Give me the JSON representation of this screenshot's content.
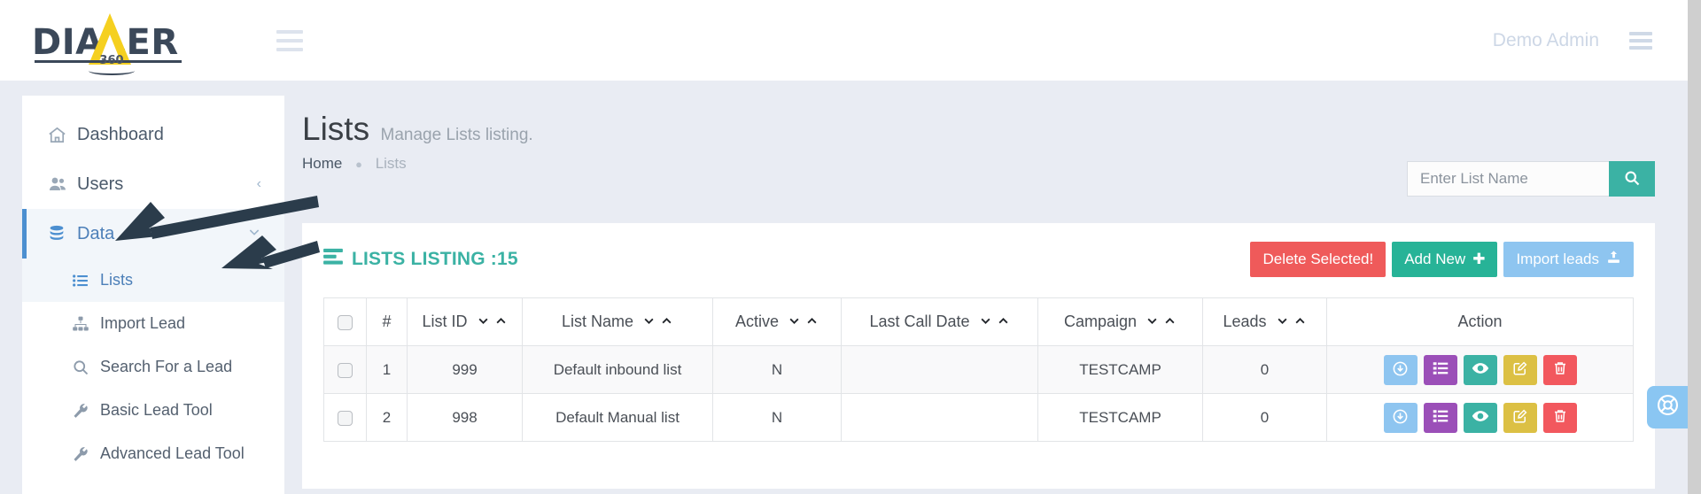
{
  "navbar": {
    "logo_text": "DIALER",
    "logo_badge": "360",
    "menu_toggle_icon": "hamburger-icon",
    "user_name": "Demo Admin",
    "right_menu_icon": "hamburger-icon"
  },
  "sidebar": {
    "items": [
      {
        "label": "Dashboard",
        "icon": "home-icon",
        "state": "normal",
        "caret": ""
      },
      {
        "label": "Users",
        "icon": "users-icon",
        "state": "normal",
        "caret": "‹"
      },
      {
        "label": "Data",
        "icon": "database-icon",
        "state": "active",
        "caret": "⌄"
      }
    ],
    "subitems": [
      {
        "label": "Lists",
        "icon": "list-ul-icon",
        "state": "selected"
      },
      {
        "label": "Import Lead",
        "icon": "sitemap-icon",
        "state": "normal"
      },
      {
        "label": "Search For a Lead",
        "icon": "search-icon",
        "state": "normal"
      },
      {
        "label": "Basic Lead Tool",
        "icon": "wrench-icon",
        "state": "normal"
      },
      {
        "label": "Advanced Lead Tool",
        "icon": "wrench-icon",
        "state": "normal"
      }
    ]
  },
  "page": {
    "title": "Lists",
    "subtitle": "Manage Lists listing.",
    "breadcrumb_home": "Home",
    "breadcrumb_sep": "●",
    "breadcrumb_current": "Lists"
  },
  "search": {
    "placeholder": "Enter List Name",
    "value": "",
    "button_icon": "search-icon"
  },
  "panel": {
    "title": "LISTS LISTING :15",
    "title_icon": "server-list-icon",
    "buttons": [
      {
        "label": "Delete Selected!",
        "style": "danger",
        "icon": ""
      },
      {
        "label": "Add New",
        "style": "teal",
        "icon": "✚"
      },
      {
        "label": "Import leads",
        "style": "blue",
        "icon": "⬆"
      }
    ]
  },
  "table": {
    "select_all_icon": "checkbox-icon",
    "columns": [
      {
        "label": "#",
        "sortable": false
      },
      {
        "label": "List ID",
        "sortable": true
      },
      {
        "label": "List Name",
        "sortable": true
      },
      {
        "label": "Active",
        "sortable": true
      },
      {
        "label": "Last Call Date",
        "sortable": true
      },
      {
        "label": "Campaign",
        "sortable": true
      },
      {
        "label": "Leads",
        "sortable": true
      },
      {
        "label": "Action",
        "sortable": false
      }
    ],
    "sort_desc_glyph": "⌄",
    "sort_asc_glyph": "⌃",
    "rows": [
      {
        "num": "1",
        "list_id": "999",
        "list_name": "Default inbound list",
        "active": "N",
        "last_call_date": "",
        "campaign": "TESTCAMP",
        "leads": "0"
      },
      {
        "num": "2",
        "list_id": "998",
        "list_name": "Default Manual list",
        "active": "N",
        "last_call_date": "",
        "campaign": "TESTCAMP",
        "leads": "0"
      }
    ],
    "row_actions": [
      {
        "name": "download-button",
        "icon": "download-circle-icon",
        "style": "a-dl"
      },
      {
        "name": "view-leads-button",
        "icon": "list-icon",
        "style": "a-list"
      },
      {
        "name": "preview-button",
        "icon": "eye-icon",
        "style": "a-eye"
      },
      {
        "name": "edit-button",
        "icon": "edit-icon",
        "style": "a-edit"
      },
      {
        "name": "delete-button",
        "icon": "trash-icon",
        "style": "a-del"
      }
    ]
  },
  "help": {
    "icon": "lifebuoy-icon"
  },
  "colors": {
    "teal": "#3bb2a4",
    "danger": "#ef5a5a",
    "blue": "#8ec5f0",
    "purple": "#9b4fb8",
    "gold": "#dcc044",
    "accent_blue": "#4c8fd0",
    "page_bg": "#e9ecf3",
    "annotation": "#2b3c4b"
  }
}
